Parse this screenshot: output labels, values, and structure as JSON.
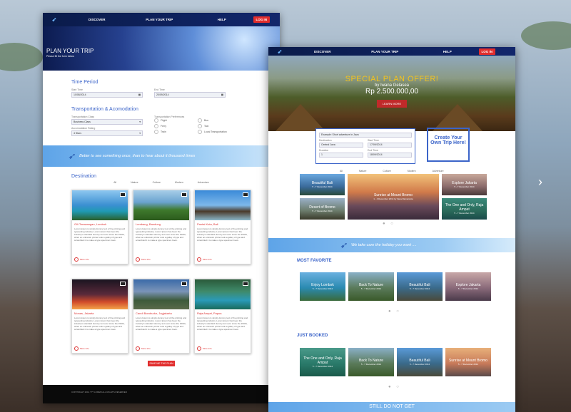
{
  "colors": {
    "accent": "#3b64c9",
    "red": "#e12d2d",
    "navy": "#0a1b4a"
  },
  "left": {
    "nav": {
      "discover": "DISCOVER",
      "plan": "PLAN YOUR TRIP",
      "help": "HELP",
      "login": "LOG IN"
    },
    "hero": {
      "title": "PLAN YOUR TRIP",
      "subtitle": "Please fill the form below"
    },
    "time": {
      "title": "Time Period",
      "start_label": "Start Time",
      "start_value": "10/08/2014",
      "end_label": "End Time",
      "end_value": "20/09/2014"
    },
    "transport": {
      "title": "Transportation & Acomodation",
      "class_label": "Transportation Class",
      "class_value": "Business Class",
      "acc_label": "Accomodation Rating",
      "acc_value": "4 Stars",
      "pref_label": "Transportation Preferences",
      "prefs": [
        "Flight",
        "Ferry",
        "Train",
        "Bus",
        "Taxi",
        "Local Transportation"
      ]
    },
    "quote": "Better to see something once, than to hear about it thousand times",
    "dest_title": "Destination",
    "filters": [
      "All",
      "Nature",
      "Culture",
      "Modern",
      "Adventure"
    ],
    "cards": [
      {
        "title": "Gili Terawangan, Lombok",
        "desc": "Lorem Ipsum is simply dummy text of the printing and typesetting industry. Lorem Ipsum has been the industry's standard dummy text ever since the 1500s, when an unknown printer took a galley of type and scrambled it to make a type specimen book.",
        "more": "More Info"
      },
      {
        "title": "Lembang, Bandung",
        "desc": "Lorem Ipsum is simply dummy text of the printing and typesetting industry. Lorem Ipsum has been the industry's standard dummy text ever since the 1500s, when an unknown printer took a galley of type and scrambled it to make a type specimen book.",
        "more": "More Info"
      },
      {
        "title": "Pantai Kuta, Bali",
        "desc": "Lorem Ipsum is simply dummy text of the printing and typesetting industry. Lorem Ipsum has been the industry's standard dummy text ever since the 1500s, when an unknown printer took a galley of type and scrambled it to make a type specimen book.",
        "more": "More Info"
      },
      {
        "title": "Monas, Jakarta",
        "desc": "Lorem Ipsum is simply dummy text of the printing and typesetting industry. Lorem Ipsum has been the industry's standard dummy text ever since the 1500s, when an unknown printer took a galley of type and scrambled it to make a type specimen book.",
        "more": "More Info"
      },
      {
        "title": "Candi Borobudur, Jogjakarta",
        "desc": "Lorem Ipsum is simply dummy text of the printing and typesetting industry. Lorem Ipsum has been the industry's standard dummy text ever since the 1500s, when an unknown printer took a galley of type and scrambled it to make a type specimen book.",
        "more": "More Info"
      },
      {
        "title": "Raja Ampat, Papua",
        "desc": "Lorem Ipsum is simply dummy text of the printing and typesetting industry. Lorem Ipsum has been the industry's standard dummy text ever since the 1500s, when an unknown printer took a galley of type and scrambled it to make a type specimen book.",
        "more": "More Info"
      }
    ],
    "save_button": "SAVE ME THE PLAN",
    "footer": "COPYRIGHT 2014 ??? LOREM ALL RIGHTS RESERVED"
  },
  "right": {
    "nav": {
      "discover": "DISCOVER",
      "plan": "PLAN YOUR TRIP",
      "help": "HELP",
      "login": "LOG IN"
    },
    "hero": {
      "offer": "SPECIAL PLAN OFFER!",
      "by": "by Iwana Gelasea",
      "price": "Rp 2.500.000,00",
      "learn": "LEARN MORE"
    },
    "search": {
      "placeholder": "Example: Short adventure in Java",
      "dest_label": "Destination",
      "dest_value": "Central Java",
      "start_label": "Start Time",
      "start_value": "17/09/2014",
      "dur_label": "Duration",
      "dur_value": "1",
      "end_label": "End Time",
      "end_value": "18/09/2014"
    },
    "create": "Create Your Own Trip Here!",
    "filters": [
      "All",
      "Nature",
      "Culture",
      "Modern",
      "Adventure"
    ],
    "gallery": [
      {
        "title": "Beautiful Bali",
        "sub": "5 - 7 December 2014"
      },
      {
        "title": "Desert of Bromo",
        "sub": "5 - 7 December 2014"
      },
      {
        "title": "Sunrise at Mount Bromo",
        "sub": "1 - 4 December 2014  by Ilana Ramanduw"
      },
      {
        "title": "Explore Jakarta",
        "sub": "5 - 7 December 2014"
      },
      {
        "title": "The One and Only, Raja Ampat",
        "sub": "5 - 7 December 2014"
      }
    ],
    "tagline": "We take care the holiday you want ....",
    "most_favorite": "MOST FAVORITE",
    "fav": [
      {
        "title": "Enjoy Lombok",
        "sub": "5 - 7 December 2014"
      },
      {
        "title": "Back To Nature",
        "sub": "5 - 7 December 2014"
      },
      {
        "title": "Beautiful Bali",
        "sub": "5 - 7 December 2014"
      },
      {
        "title": "Explore Jakarta",
        "sub": "5 - 7 December 2014"
      }
    ],
    "just_booked": "JUST BOOKED",
    "booked": [
      {
        "title": "The One and Only, Raja Ampat",
        "sub": "5 - 7 December 2014"
      },
      {
        "title": "Back To Nature",
        "sub": "5 - 7 December 2014"
      },
      {
        "title": "Beautiful Bali",
        "sub": "5 - 7 December 2014"
      },
      {
        "title": "Sunrise at Mount Bromo",
        "sub": "5 - 7 December 2014"
      }
    ],
    "bottom": "STILL DO NOT GET"
  }
}
